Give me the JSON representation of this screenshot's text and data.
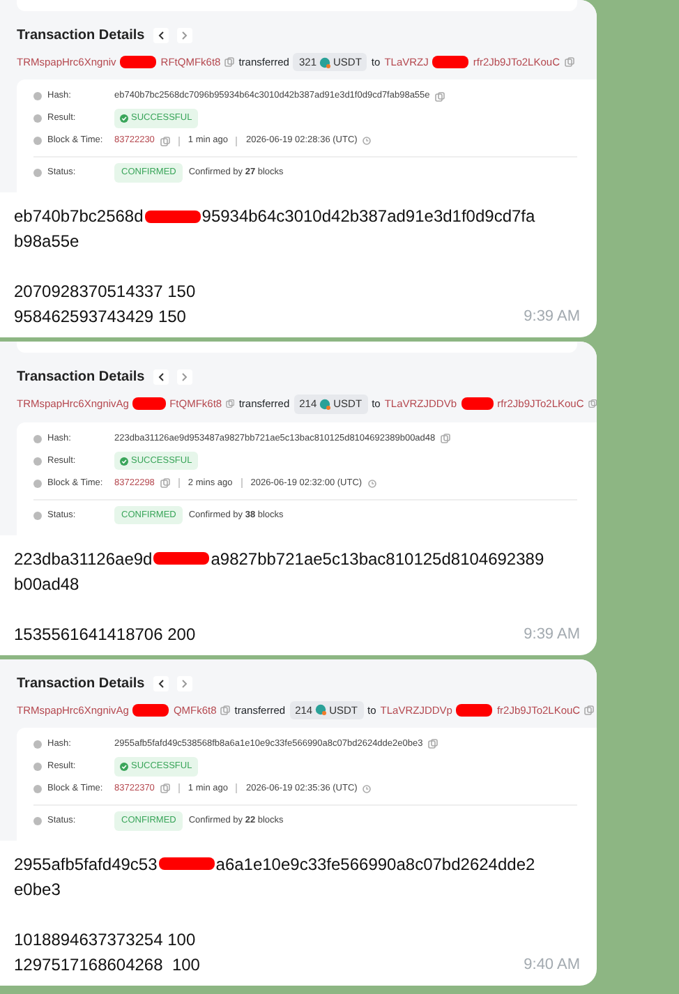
{
  "messages": [
    {
      "screenshot": {
        "title": "Transaction Details",
        "from": {
          "before": "TRMspapHrc6Xngniv",
          "after": "RFtQMFk6t8"
        },
        "action": "transferred",
        "amount": "321",
        "token": "USDT",
        "to_word": "to",
        "to": {
          "before": "TLaVRZJ",
          "after": "rfr2Jb9JTo2LKouC"
        },
        "fields": [
          {
            "kind": "hash",
            "label": "Hash:",
            "value": "eb740b7bc2568dc7096b95934b64c3010d42b387ad91e3d1f0d9cd7fab98a55e"
          },
          {
            "kind": "result",
            "label": "Result:",
            "value": "SUCCESSFUL"
          },
          {
            "kind": "block",
            "label": "Block & Time:",
            "block": "83722230",
            "age": "1 min ago",
            "time": "2026-06-19 02:28:36 (UTC)"
          },
          {
            "kind": "status",
            "label": "Status:",
            "value": "CONFIRMED",
            "note": "Confirmed by **27** blocks"
          }
        ]
      },
      "text": {
        "hash_before": "eb740b7bc2568d",
        "hash_after": "95934b64c3010d42b387ad91e3d1f0d9cd7fa",
        "hash_end": "b98a55e",
        "lines": [
          "2070928370514337 150",
          "958462593743429 150"
        ]
      },
      "time": "9:39 AM"
    },
    {
      "screenshot": {
        "title": "Transaction Details",
        "from": {
          "before": "TRMspapHrc6XngnivAg",
          "after": "FtQMFk6t8"
        },
        "action": "transferred",
        "amount": "214",
        "token": "USDT",
        "to_word": "to",
        "to": {
          "before": "TLaVRZJDDVb",
          "after": "rfr2Jb9JTo2LKouC"
        },
        "fields": [
          {
            "kind": "hash",
            "label": "Hash:",
            "value": "223dba31126ae9d953487a9827bb721ae5c13bac810125d8104692389b00ad48"
          },
          {
            "kind": "result",
            "label": "Result:",
            "value": "SUCCESSFUL"
          },
          {
            "kind": "block",
            "label": "Block & Time:",
            "block": "83722298",
            "age": "2 mins ago",
            "time": "2026-06-19 02:32:00 (UTC)"
          },
          {
            "kind": "status",
            "label": "Status:",
            "value": "CONFIRMED",
            "note": "Confirmed by **38** blocks"
          }
        ]
      },
      "text": {
        "hash_before": "223dba31126ae9d",
        "hash_after": "a9827bb721ae5c13bac810125d8104692389",
        "hash_end": "b00ad48",
        "lines": [
          "1535561641418706 200"
        ]
      },
      "time": "9:39 AM"
    },
    {
      "screenshot": {
        "title": "Transaction Details",
        "from": {
          "before": "TRMspapHrc6XngnivAg",
          "after": "QMFk6t8"
        },
        "action": "transferred",
        "amount": "214",
        "token": "USDT",
        "to_word": "to",
        "to": {
          "before": "TLaVRZJDDVp",
          "after": "fr2Jb9JTo2LKouC"
        },
        "fields": [
          {
            "kind": "hash",
            "label": "Hash:",
            "value": "2955afb5fafd49c538568fb8a6a1e10e9c33fe566990a8c07bd2624dde2e0be3"
          },
          {
            "kind": "result",
            "label": "Result:",
            "value": "SUCCESSFUL"
          },
          {
            "kind": "block",
            "label": "Block & Time:",
            "block": "83722370",
            "age": "1 min ago",
            "time": "2026-06-19 02:35:36 (UTC)"
          },
          {
            "kind": "status",
            "label": "Status:",
            "value": "CONFIRMED",
            "note": "Confirmed by **22** blocks"
          }
        ]
      },
      "text": {
        "hash_before": "2955afb5fafd49c53",
        "hash_after": "a6a1e10e9c33fe566990a8c07bd2624dde2",
        "hash_end": "e0be3",
        "lines": [
          "1018894637373254 100",
          "1297517168604268  100"
        ]
      },
      "time": "9:40 AM"
    }
  ]
}
